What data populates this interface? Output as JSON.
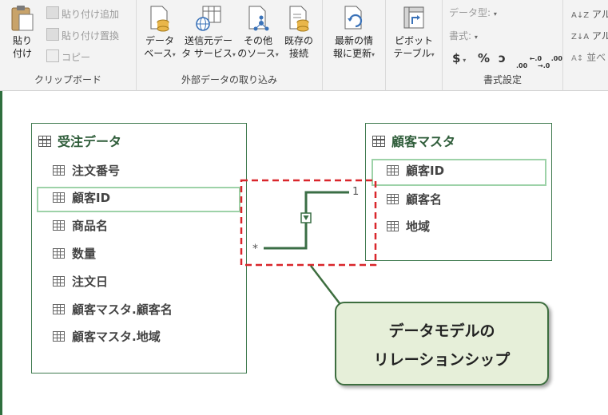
{
  "ribbon": {
    "clipboard": {
      "paste_label_1": "貼り",
      "paste_label_2": "付け",
      "paste_append": "貼り付け追加",
      "paste_replace": "貼り付け置換",
      "copy": "コピー",
      "group_label": "クリップボード"
    },
    "external": {
      "database_1": "データ",
      "database_2": "ベース",
      "dataservice_1": "送信元デー",
      "dataservice_2": "タ サービス",
      "other_1": "その他",
      "other_2": "のソース",
      "existing_1": "既存の",
      "existing_2": "接続",
      "group_label": "外部データの取り込み"
    },
    "refresh_1": "最新の情",
    "refresh_2": "報に更新",
    "pivot_1": "ピボット",
    "pivot_2": "テーブル",
    "format": {
      "datatype": "データ型:",
      "format": "書式:",
      "currency": "$",
      "percent": "%",
      "comma": "ɔ",
      "inc_decimal": "←.0\n.00",
      "dec_decimal": ".00\n→.0",
      "group_label": "書式設定"
    },
    "sort": {
      "az": "アル",
      "za": "アル",
      "sortby": "並べ"
    }
  },
  "tables": {
    "orders": {
      "title": "受注データ",
      "fields": [
        "注文番号",
        "顧客ID",
        "商品名",
        "数量",
        "注文日",
        "顧客マスタ.顧客名",
        "顧客マスタ.地域"
      ]
    },
    "customers": {
      "title": "顧客マスタ",
      "fields": [
        "顧客ID",
        "顧客名",
        "地域"
      ]
    }
  },
  "relationship": {
    "many_marker": "*",
    "one_marker": "1"
  },
  "callout": {
    "line1": "データモデルの",
    "line2": "リレーションシップ"
  },
  "colors": {
    "accent_green": "#3f7a4f",
    "highlight": "#9dd2a8",
    "callout_bg": "#e6efd9",
    "dashed_red": "#d9262b"
  }
}
